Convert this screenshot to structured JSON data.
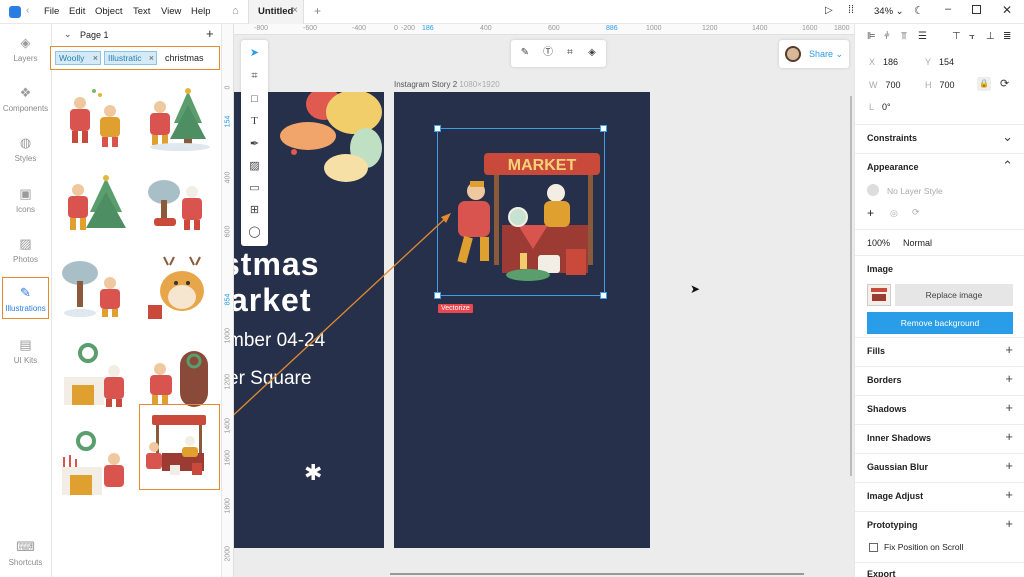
{
  "menu": {
    "items": [
      "File",
      "Edit",
      "Object",
      "Text",
      "View",
      "Help"
    ]
  },
  "tab": {
    "title": "Untitled"
  },
  "topbar": {
    "zoom": "34%"
  },
  "left_nav": {
    "items": [
      "Layers",
      "Components",
      "Styles",
      "Icons",
      "Photos",
      "Illustrations",
      "UI Kits"
    ],
    "bottom": "Shortcuts"
  },
  "panel": {
    "page": "Page 1",
    "chips": [
      "Woolly",
      "Illustratic"
    ],
    "search_value": "christmas"
  },
  "ruler": {
    "top": [
      "-800",
      "-600",
      "-400",
      "-200",
      "0",
      "186",
      "400",
      "600",
      "886",
      "1000",
      "1200",
      "1400",
      "1600",
      "1800"
    ],
    "left": [
      "0",
      "154",
      "400",
      "600",
      "854",
      "1000",
      "1200",
      "1400",
      "1600",
      "1800",
      "2000"
    ]
  },
  "canvas": {
    "artboard_label": "Instagram Story 2",
    "artboard_size": "1080×1920",
    "poster": {
      "line1": "stmas",
      "line2": "arket",
      "line3": "mber 04-24",
      "line4": "er Square"
    },
    "market_sign": "MARKET",
    "vectorize_label": "Vectorize"
  },
  "share": {
    "label": "Share"
  },
  "inspector": {
    "x_label": "X",
    "x": "186",
    "y_label": "Y",
    "y": "154",
    "w_label": "W",
    "w": "700",
    "h_label": "H",
    "h": "700",
    "rot_label": "L",
    "rotation": "0°",
    "constraints": "Constraints",
    "appearance": "Appearance",
    "layer_style": "No Layer Style",
    "opacity": "100%",
    "blend": "Normal",
    "image": "Image",
    "replace": "Replace image",
    "remove_bg": "Remove background",
    "sections": [
      "Fills",
      "Borders",
      "Shadows",
      "Inner Shadows",
      "Gaussian Blur",
      "Image Adjust",
      "Prototyping"
    ],
    "fix_position": "Fix Position on Scroll",
    "export": "Export"
  },
  "colors": {
    "accent": "#2a9de8",
    "highlight": "#e58b2e",
    "artboard": "#27304a",
    "vectorize": "#e8474f"
  }
}
